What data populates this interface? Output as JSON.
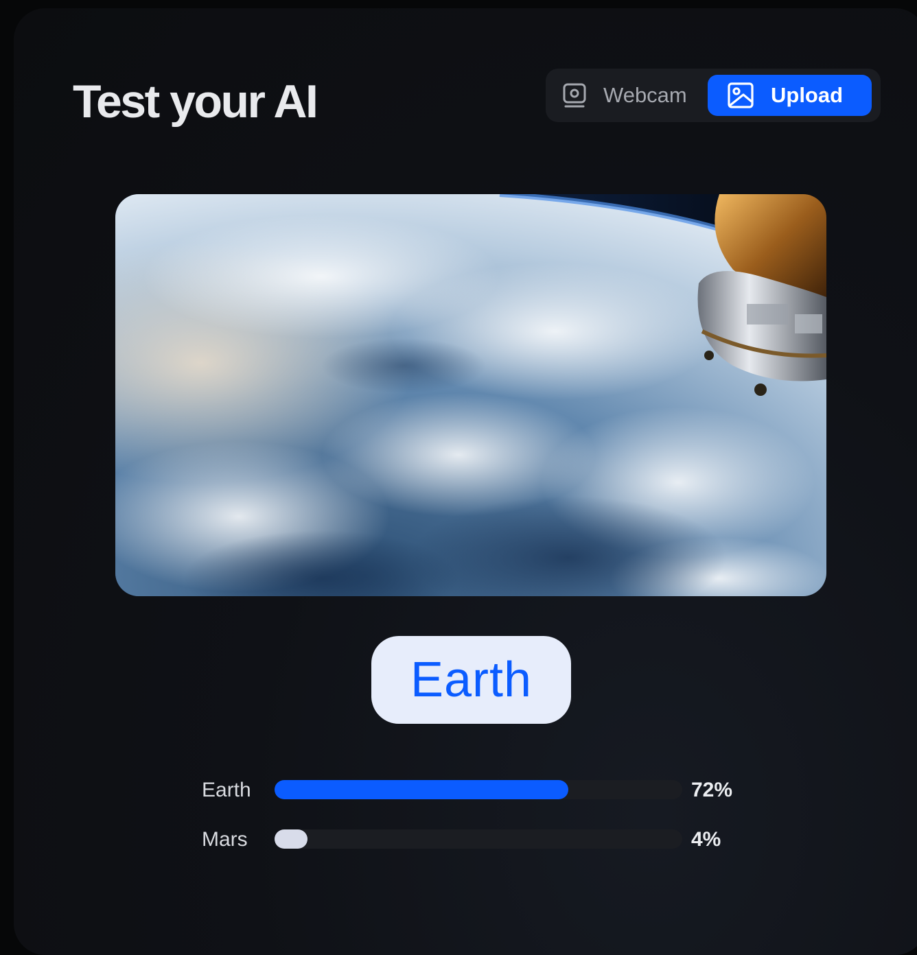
{
  "header": {
    "title": "Test your AI"
  },
  "source_toggle": {
    "webcam_label": "Webcam",
    "upload_label": "Upload",
    "selected": "Upload",
    "webcam_icon": "webcam-icon",
    "upload_icon": "image-icon",
    "accent_color": "#0b5cff"
  },
  "preview": {
    "image": "earth-from-space-photo"
  },
  "prediction": {
    "label": "Earth"
  },
  "confidence": [
    {
      "label": "Earth",
      "value": 72,
      "display": "72%",
      "color": "#0b5cff"
    },
    {
      "label": "Mars",
      "value": 4,
      "display": "4%",
      "color": "#d8dcea"
    }
  ]
}
